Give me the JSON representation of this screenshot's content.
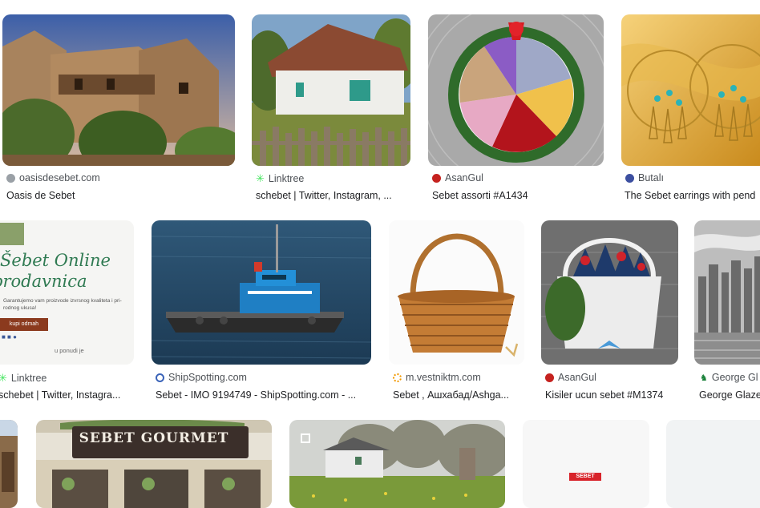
{
  "results": [
    {
      "source": "oasisdesebet.com",
      "title": "Oasis de Sebet",
      "fav_color": "#9aa0a6"
    },
    {
      "source": "Linktree",
      "title": "schebet | Twitter, Instagram, ...",
      "fav_color": "#43e55e"
    },
    {
      "source": "AsanGul",
      "title": "Sebet assorti #A1434",
      "fav_color": "#c5221f"
    },
    {
      "source": "Butalı",
      "title": "The Sebet earrings with pend",
      "fav_color": "#3c4fa0"
    },
    {
      "source": "Linktree",
      "title": "schebet | Twitter, Instagra...",
      "fav_color": "#43e55e"
    },
    {
      "source": "ShipSpotting.com",
      "title": "Sebet - IMO 9194749 - ShipSpotting.com - ...",
      "fav_color": "#3a63b8"
    },
    {
      "source": "m.vestniktm.com",
      "title": "Sebet , Ашхабад/Ashga...",
      "fav_color": "#f29900"
    },
    {
      "source": "AsanGul",
      "title": "Kisiler ucun sebet #M1374",
      "fav_color": "#c5221f"
    },
    {
      "source": "George Gl",
      "title": "George Glaze",
      "fav_color": "#188038"
    }
  ],
  "promo": {
    "headline_1": "Šebet Online",
    "headline_2": "prodavnica",
    "body": "Garantujemo vam proizvode izvrsnog kvaliteta i pri-rodnog ukusa!",
    "button": "kupi odmah",
    "link": "u ponudi je"
  },
  "storefront_sign": "SEBET GOURMET",
  "logo_text": "SEBET"
}
